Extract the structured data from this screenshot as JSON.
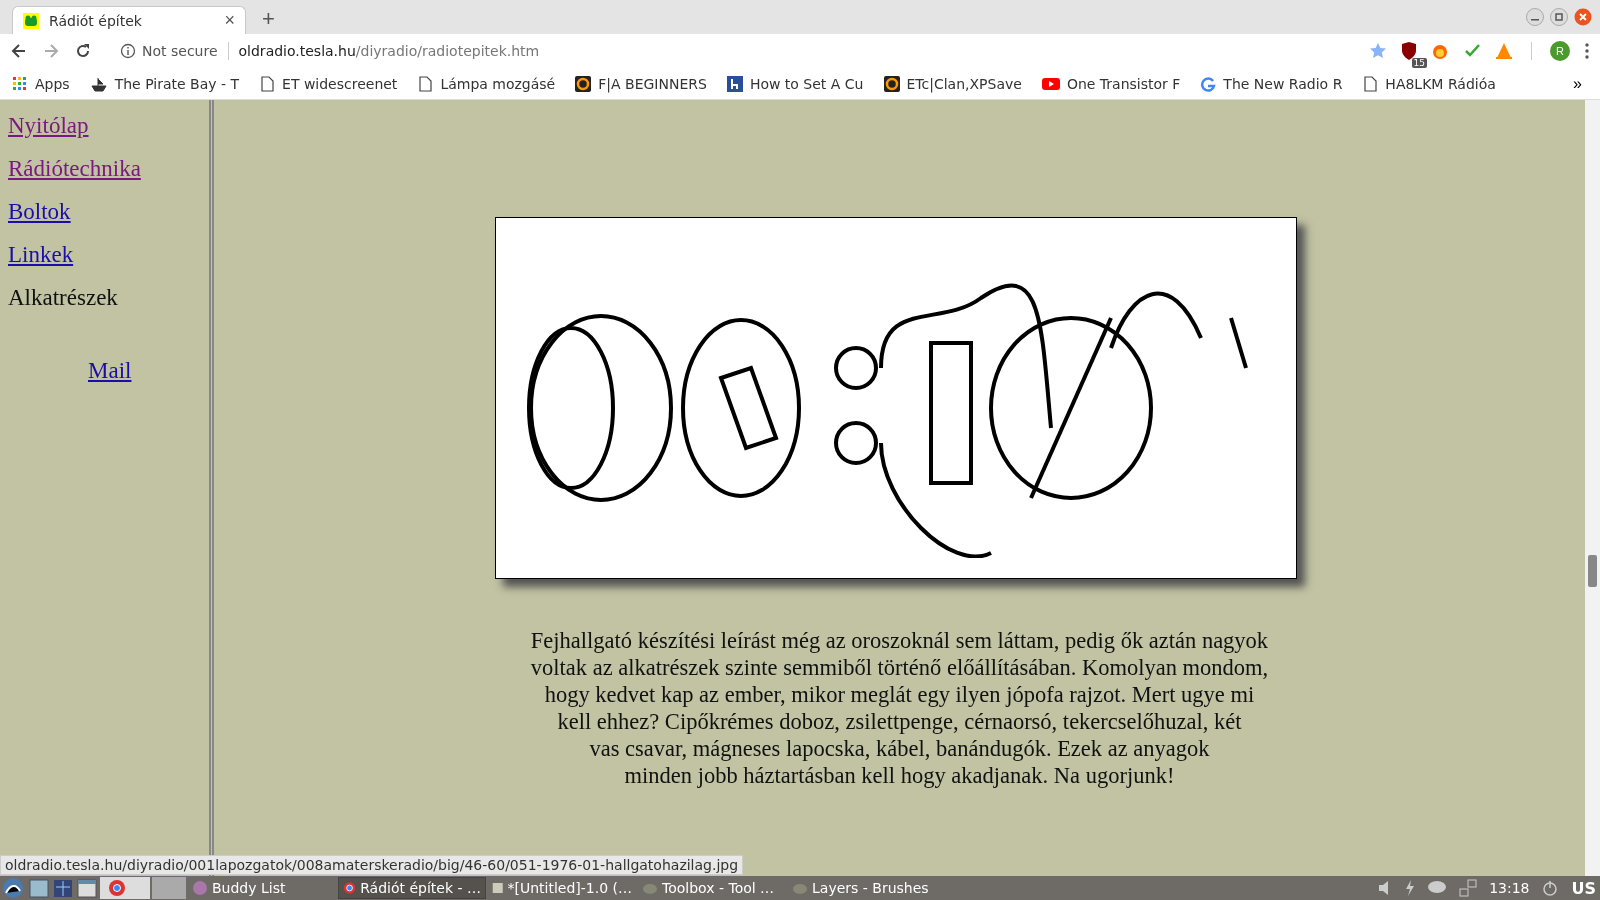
{
  "tab": {
    "title": "Rádiót építek",
    "close": "×",
    "new_tab": "+"
  },
  "address_bar": {
    "security": "Not secure",
    "host": "oldradio.tesla.hu",
    "path": "/diyradio/radiotepitek.htm"
  },
  "extension_badge": "15",
  "profile": "R",
  "bookmarks": [
    {
      "label": "Apps",
      "kind": "apps"
    },
    {
      "label": "The Pirate Bay - T",
      "kind": "ship"
    },
    {
      "label": "ET widescreenet",
      "kind": "page"
    },
    {
      "label": "Lámpa mozgásé",
      "kind": "page"
    },
    {
      "label": "F|A BEGINNERS",
      "kind": "game"
    },
    {
      "label": "How to Set A Cu",
      "kind": "h"
    },
    {
      "label": "ETc|Clan,XPSave",
      "kind": "game"
    },
    {
      "label": "One Transistor F",
      "kind": "video"
    },
    {
      "label": "The New Radio R",
      "kind": "g"
    },
    {
      "label": "HA8LKM Rádióa",
      "kind": "page"
    }
  ],
  "bookmarks_more": "»",
  "sidebar": {
    "links": [
      {
        "label": "Nyitólap",
        "kind": "link",
        "visited": true
      },
      {
        "label": "Rádiótechnika",
        "kind": "link",
        "visited": true
      },
      {
        "label": "Boltok",
        "kind": "link",
        "visited": false
      },
      {
        "label": "Linkek",
        "kind": "link",
        "visited": false
      },
      {
        "label": "Alkatrészek",
        "kind": "current"
      }
    ],
    "mail": "Mail"
  },
  "article": {
    "lines": [
      "Fejhallgató készítési leírást még az oroszoknál sem láttam, pedig ők aztán nagyok",
      "voltak az alkatrészek szinte semmiből történő előállításában. Komolyan mondom,",
      "hogy kedvet kap az ember, mikor meglát egy ilyen jópofa rajzot. Mert ugye mi",
      "kell ehhez? Cipőkrémes doboz, zsilettpenge, cérnaorsó, tekercselőhuzal, két",
      "vas csavar, mágneses lapocska, kábel, banándugók. Ezek az anyagok",
      "minden jobb háztartásban kell hogy akadjanak. Na ugorjunk!"
    ]
  },
  "status_url": "oldradio.tesla.hu/diyradio/001lapozgatok/008amaterskeradio/big/46-60/051-1976-01-hallgatohazilag.jpg",
  "taskbar": {
    "windows": [
      {
        "label": "Buddy List",
        "kind": "chat",
        "selected": false
      },
      {
        "label": "Rádiót építek - …",
        "kind": "browser",
        "selected": true
      },
      {
        "label": "*[Untitled]-1.0 (…",
        "kind": "image",
        "selected": false
      },
      {
        "label": "Toolbox - Tool …",
        "kind": "gimp",
        "selected": false
      },
      {
        "label": "Layers - Brushes",
        "kind": "gimp",
        "selected": false
      }
    ],
    "clock": "13:18",
    "keyboard": "US"
  }
}
